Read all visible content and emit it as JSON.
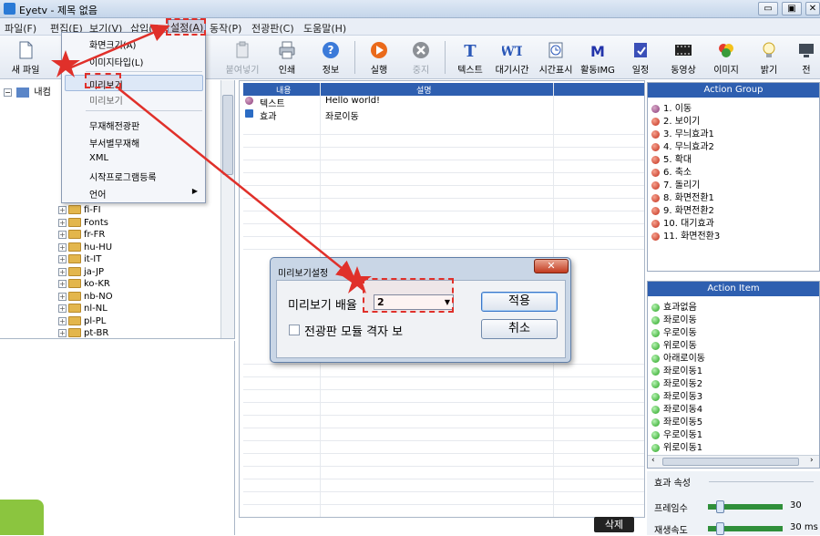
{
  "window": {
    "title": "Eyetv - 제목 없음",
    "controls": [
      "▭",
      "▣",
      "✕"
    ]
  },
  "menubar": {
    "items": [
      "파일(F)",
      "편집(E)",
      "보기(V)",
      "삽입(I)",
      "설정(A)",
      "동작(P)",
      "전광판(C)",
      "도움말(H)"
    ],
    "active": "설정(A)"
  },
  "toolbar": {
    "items": [
      {
        "label": "새 파일",
        "icon": "new-file-icon",
        "enabled": true
      },
      {
        "label": "붙여넣기",
        "icon": "paste-icon",
        "enabled": false
      },
      {
        "label": "인쇄",
        "icon": "print-icon",
        "enabled": true
      },
      {
        "label": "정보",
        "icon": "info-icon",
        "enabled": true
      },
      {
        "label": "실행",
        "icon": "run-icon",
        "enabled": true
      },
      {
        "label": "중지",
        "icon": "stop-icon",
        "enabled": false
      },
      {
        "label": "텍스트",
        "icon": "text-icon",
        "enabled": true
      },
      {
        "label": "대기시간",
        "icon": "wait-time-icon",
        "enabled": true
      },
      {
        "label": "시간표시",
        "icon": "time-display-icon",
        "enabled": true
      },
      {
        "label": "활동IMG",
        "icon": "activity-img-icon",
        "enabled": true
      },
      {
        "label": "일정",
        "icon": "schedule-icon",
        "enabled": true
      },
      {
        "label": "동영상",
        "icon": "video-icon",
        "enabled": true
      },
      {
        "label": "이미지",
        "icon": "image-icon",
        "enabled": true
      },
      {
        "label": "밝기",
        "icon": "brightness-icon",
        "enabled": true
      }
    ],
    "truncated_label": "전"
  },
  "settings_menu": {
    "items": [
      "화면크기(A)",
      "이미지타입(L)",
      "미리보기",
      "미리보기",
      "무재해전광판",
      "부서별무재해",
      "XML",
      "시작프로그램등록",
      "언어"
    ],
    "highlighted": "미리보기"
  },
  "tree": {
    "top_label": "내컴",
    "folders": [
      "fi-FI",
      "Fonts",
      "fr-FR",
      "hu-HU",
      "it-IT",
      "ja-JP",
      "ko-KR",
      "nb-NO",
      "nl-NL",
      "pl-PL",
      "pt-BR"
    ]
  },
  "grid": {
    "columns": [
      "내용",
      "설명"
    ],
    "rows": [
      {
        "type": "텍스트",
        "desc": "Hello world!"
      },
      {
        "type": "효과",
        "desc": "좌로이동"
      }
    ]
  },
  "delete_button": "삭제",
  "action_group": {
    "title": "Action Group",
    "items": [
      "1. 이동",
      "2. 보이기",
      "3. 무늬효과1",
      "4. 무늬효과2",
      "5. 확대",
      "6. 축소",
      "7. 돌리기",
      "8. 화면전환1",
      "9. 화면전환2",
      "10. 대기효과",
      "11. 화면전환3"
    ]
  },
  "action_item": {
    "title": "Action Item",
    "items": [
      "효과없음",
      "좌로이동",
      "우로이동",
      "위로이동",
      "아래로이동",
      "좌로이동1",
      "좌로이동2",
      "좌로이동3",
      "좌로이동4",
      "좌로이동5",
      "우로이동1",
      "위로이동1"
    ]
  },
  "effect_props": {
    "title": "효과 속성",
    "frames_label": "프레임수",
    "frames_value": "30",
    "frames_level": 0.12,
    "speed_label": "재생속도",
    "speed_value": "30 ms",
    "speed_level": 0.12
  },
  "dialog": {
    "title": "미리보기설정",
    "zoom_label": "미리보기 배율",
    "zoom_value": "2",
    "checkbox_label": "전광판 모듈 격자 보",
    "checkbox_checked": false,
    "apply": "적용",
    "cancel": "취소"
  },
  "colors": {
    "accent": "#2e5fb0",
    "highlight": "#e0302a",
    "arrow": "#e0302a",
    "corner": "#8bc53f"
  }
}
